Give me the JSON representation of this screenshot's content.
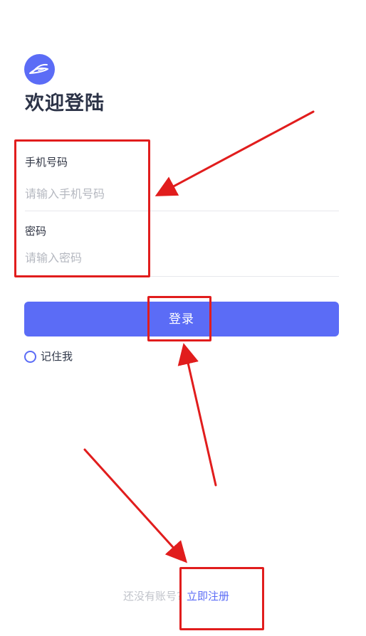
{
  "page": {
    "title": "欢迎登陆"
  },
  "logo": {
    "icon": "feather-icon",
    "color": "#5b6cf6"
  },
  "form": {
    "phone": {
      "label": "手机号码",
      "placeholder": "请输入手机号码",
      "value": ""
    },
    "password": {
      "label": "密码",
      "placeholder": "请输入密码",
      "value": ""
    }
  },
  "actions": {
    "login_label": "登录",
    "remember_label": "记住我"
  },
  "footer": {
    "register_tip": "还没有账号?",
    "register_link": "立即注册"
  },
  "colors": {
    "primary": "#5b6cf6",
    "annotation": "#e11d1d",
    "divider": "#e7e8ec",
    "muted_text": "#c0c3ca"
  }
}
